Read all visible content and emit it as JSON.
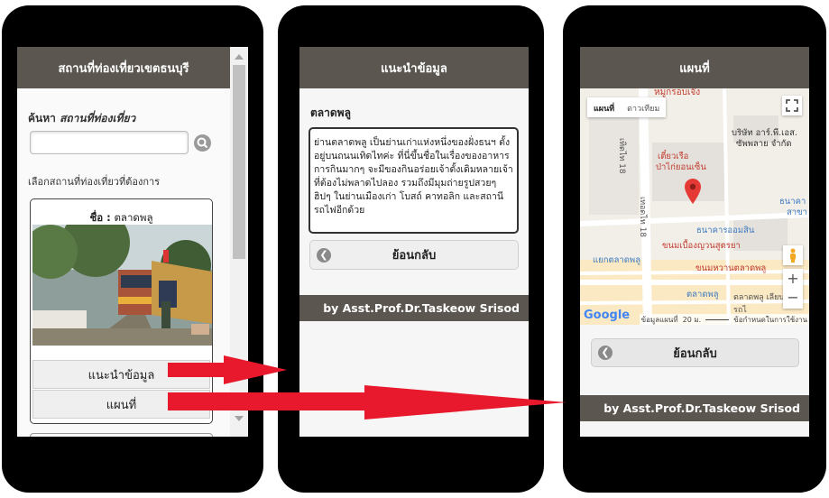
{
  "screen1": {
    "header": "สถานที่ท่องเที่ยวเขตธนบุรี",
    "search_label_prefix": "ค้นหา",
    "search_label_italic": "สถานที่ท่องเที่ยว",
    "search_value": "",
    "select_label": "เลือกสถานที่ท่องเที่ยวที่ต้องการ",
    "card_name_prefix": "ชื่อ :",
    "card_name": "ตลาดพลู",
    "btn_info": "แนะนำข้อมูล",
    "btn_map": "แผนที่"
  },
  "screen2": {
    "header": "แนะนำข้อมูล",
    "place_title": "ตลาดพลู",
    "description": "ย่านตลาดพลู เป็นย่านเก่าแห่งหนึ่งของฝั่งธนฯ ตั้งอยู่บนถนนเทิดไทค่ะ ที่นี่ขึ้นชื่อในเรื่องของอาหารการกินมากๆ จะมีของกินอร่อยเจ้าดั้งเดิมหลายเจ้าที่ต้องไม่พลาดไปลอง รวมถึงมีมุมถ่ายรูปสวยๆ ฮิปๆ ในย่านเมืองเก่า โบสถ์ คาทอลิก และสถานีรถไฟอีกด้วย",
    "back": "ย้อนกลับ",
    "footer": "by Asst.Prof.Dr.Taskeow Srisod"
  },
  "screen3": {
    "header": "แผนที่",
    "map_type_map": "แผนที่",
    "map_type_sat": "ดาวเทียม",
    "labels": {
      "top": "หมูกรอบเจ๊ง",
      "brisat": "บริษัท อาร์.พี.เอส.",
      "brisat2": "ซัพพลาย จำกัด",
      "tiao": "เตี๋ยวเรือ",
      "tiao2": "ป่าไก่ยอนเซ็น",
      "thanakarn": "ธนาคารออมสิน",
      "thanakarn_side": "ธนาคา",
      "sakha": "สาขา",
      "khanom": "ขนมเบื้องญวนสูตรยา",
      "yaek": "แยกตลาดพลู",
      "khanomwan": "ขนมหวานตลาดพลู",
      "talat": "ตลาดพลู",
      "road_thoet": "เทิดไท 18",
      "road_thoet2": "เทอดไท 18",
      "road_side": "ตลาดพลู เลียบทางรถไ"
    },
    "google": "Google",
    "map_data": "ข้อมูลแผนที่",
    "scale": "20 ม.",
    "terms": "ข้อกำหนดในการใช้งาน",
    "back": "ย้อนกลับ",
    "footer": "by Asst.Prof.Dr.Taskeow Srisod"
  }
}
